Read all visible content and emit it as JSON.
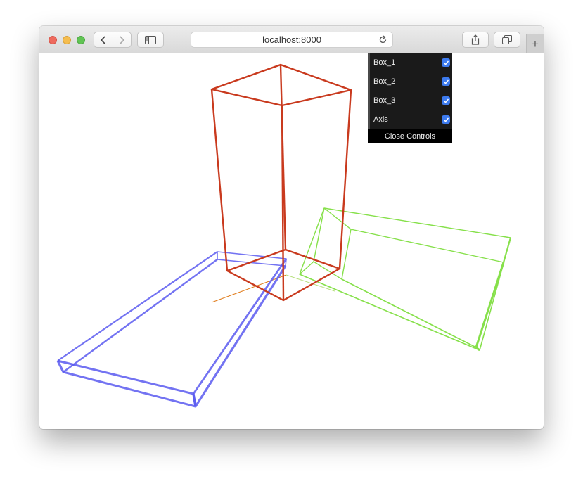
{
  "browser": {
    "url": "localhost:8000",
    "new_tab_label": "+"
  },
  "controls": {
    "items": [
      {
        "label": "Box_1",
        "checked": true
      },
      {
        "label": "Box_2",
        "checked": true
      },
      {
        "label": "Box_3",
        "checked": true
      },
      {
        "label": "Axis",
        "checked": true
      }
    ],
    "close_label": "Close Controls"
  },
  "colors": {
    "box_1": "#c93a1e",
    "box_2": "#5a5af0",
    "box_3": "#86e04a",
    "axis_x": "#e07b1a",
    "checkbox": "#3d7bef"
  }
}
